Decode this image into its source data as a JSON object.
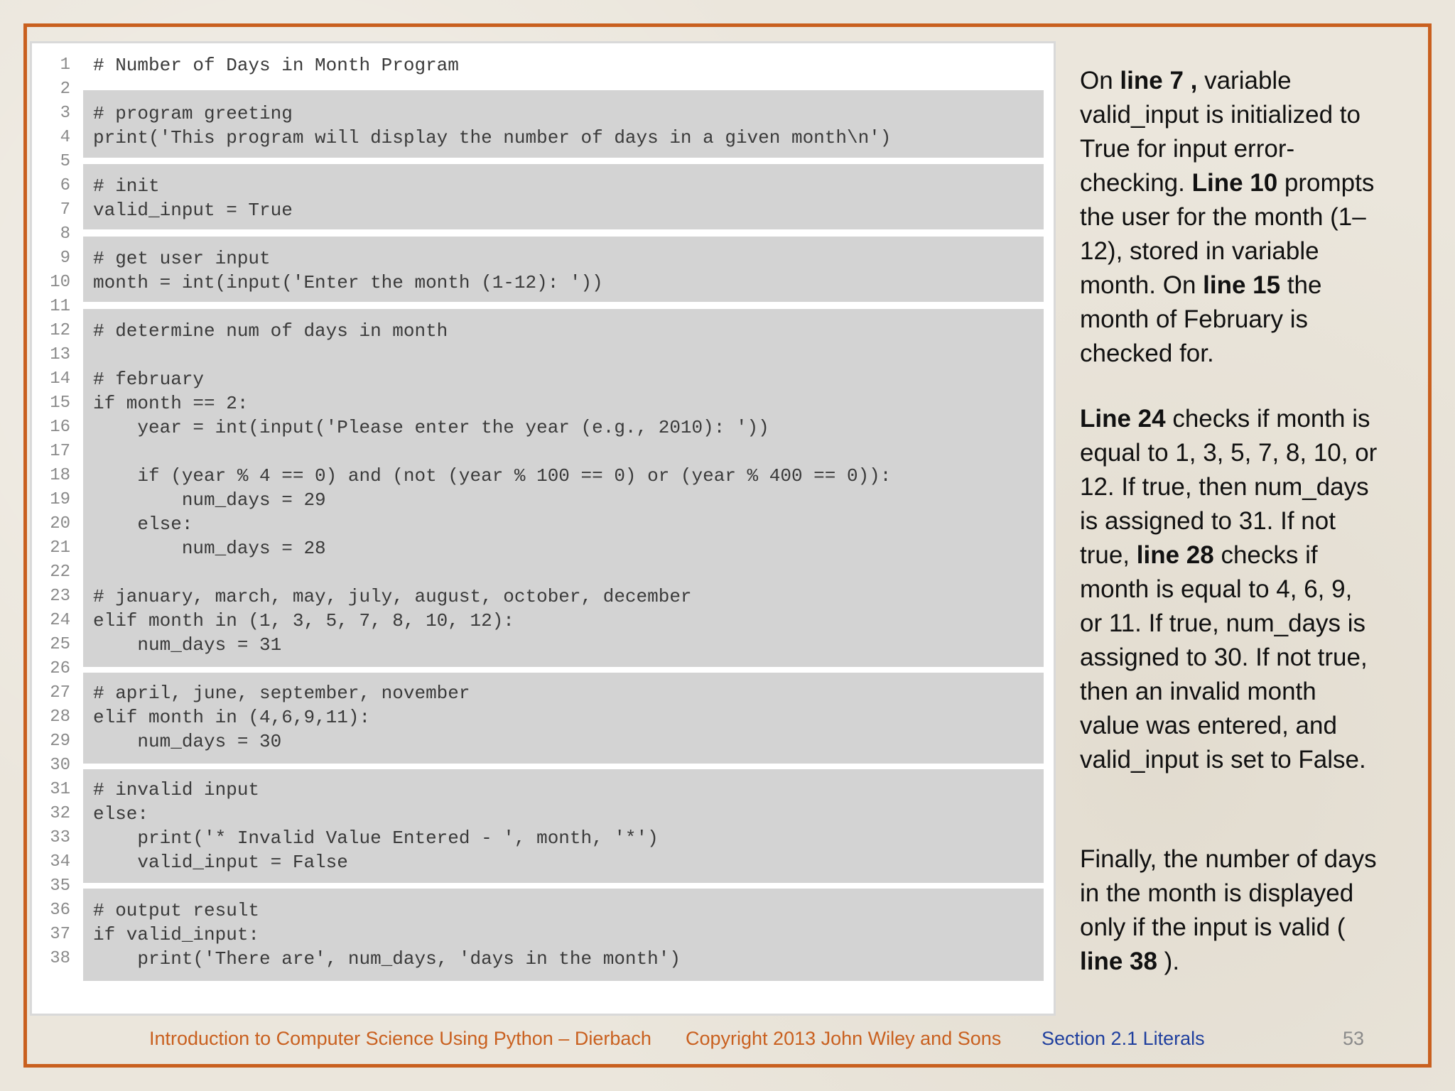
{
  "code": {
    "lines": [
      {
        "n": "1",
        "text": "# Number of Days in Month Program"
      },
      {
        "n": "2",
        "text": ""
      },
      {
        "n": "3",
        "text": "# program greeting"
      },
      {
        "n": "4",
        "text": "print('This program will display the number of days in a given month\\n')"
      },
      {
        "n": "5",
        "text": ""
      },
      {
        "n": "6",
        "text": "# init"
      },
      {
        "n": "7",
        "text": "valid_input = True"
      },
      {
        "n": "8",
        "text": ""
      },
      {
        "n": "9",
        "text": "# get user input"
      },
      {
        "n": "10",
        "text": "month = int(input('Enter the month (1-12): '))"
      },
      {
        "n": "11",
        "text": ""
      },
      {
        "n": "12",
        "text": "# determine num of days in month"
      },
      {
        "n": "13",
        "text": ""
      },
      {
        "n": "14",
        "text": "# february"
      },
      {
        "n": "15",
        "text": "if month == 2:"
      },
      {
        "n": "16",
        "text": "    year = int(input('Please enter the year (e.g., 2010): '))"
      },
      {
        "n": "17",
        "text": ""
      },
      {
        "n": "18",
        "text": "    if (year % 4 == 0) and (not (year % 100 == 0) or (year % 400 == 0)):"
      },
      {
        "n": "19",
        "text": "        num_days = 29"
      },
      {
        "n": "20",
        "text": "    else:"
      },
      {
        "n": "21",
        "text": "        num_days = 28"
      },
      {
        "n": "22",
        "text": ""
      },
      {
        "n": "23",
        "text": "# january, march, may, july, august, october, december"
      },
      {
        "n": "24",
        "text": "elif month in (1, 3, 5, 7, 8, 10, 12):"
      },
      {
        "n": "25",
        "text": "    num_days = 31"
      },
      {
        "n": "26",
        "text": ""
      },
      {
        "n": "27",
        "text": "# april, june, september, november"
      },
      {
        "n": "28",
        "text": "elif month in (4,6,9,11):"
      },
      {
        "n": "29",
        "text": "    num_days = 30"
      },
      {
        "n": "30",
        "text": ""
      },
      {
        "n": "31",
        "text": "# invalid input"
      },
      {
        "n": "32",
        "text": "else:"
      },
      {
        "n": "33",
        "text": "    print('* Invalid Value Entered - ', month, '*')"
      },
      {
        "n": "34",
        "text": "    valid_input = False"
      },
      {
        "n": "35",
        "text": ""
      },
      {
        "n": "36",
        "text": "# output result"
      },
      {
        "n": "37",
        "text": "if valid_input:"
      },
      {
        "n": "38",
        "text": "    print('There are', num_days, 'days in the month')"
      }
    ]
  },
  "explanation": {
    "p1": {
      "a": "On ",
      "b1": "line 7 ,",
      "c": " variable valid_input is initialized to True for input error-checking. ",
      "b2": "Line 10",
      "d": " prompts the user for the month (1–12), stored in variable month. On ",
      "b3": "line 15",
      "e": " the month of February is checked for."
    },
    "p2": {
      "b1": "Line 24",
      "a": " checks if month is equal to 1, 3, 5, 7, 8, 10, or 12. If true, then num_days is assigned to 31. If not true, ",
      "b2": "line 28",
      "c": " checks if month is equal to 4, 6, 9, or 11. If true, num_days is assigned to 30. If not true, then an invalid month  value was entered, and valid_input is set to False."
    },
    "p3": {
      "a": "Finally, the number of days in the month is displayed",
      "b": "only if the input is valid (",
      "c": "line 38",
      "d": " )."
    }
  },
  "footer": {
    "book": "Introduction to Computer Science Using Python – Dierbach",
    "copyright": "Copyright 2013 John Wiley and  Sons",
    "section": "Section 2.1  Literals",
    "page": "53"
  }
}
